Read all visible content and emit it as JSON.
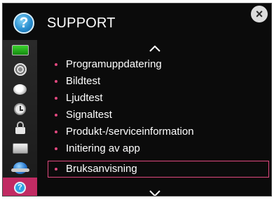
{
  "header": {
    "title": "SUPPORT",
    "badge_glyph": "?",
    "close_glyph": "×"
  },
  "sidebar": {
    "items": [
      {
        "icon": "tv-icon",
        "active": false
      },
      {
        "icon": "speaker-icon",
        "active": false
      },
      {
        "icon": "disc-icon",
        "active": false
      },
      {
        "icon": "clock-icon",
        "active": false
      },
      {
        "icon": "lock-icon",
        "active": false
      },
      {
        "icon": "hard-drive-icon",
        "active": false
      },
      {
        "icon": "globe-icon",
        "active": false
      },
      {
        "icon": "help-icon",
        "active": true,
        "glyph": "?"
      }
    ]
  },
  "menu": {
    "items": [
      {
        "label": "Programuppdatering",
        "selected": false
      },
      {
        "label": "Bildtest",
        "selected": false
      },
      {
        "label": "Ljudtest",
        "selected": false
      },
      {
        "label": "Signaltest",
        "selected": false
      },
      {
        "label": "Produkt-/serviceinformation",
        "selected": false
      },
      {
        "label": "Initiering av app",
        "selected": false
      },
      {
        "label": "Bruksanvisning",
        "selected": true
      }
    ]
  },
  "colors": {
    "panel_background": "#0b0b0b",
    "accent": "#c12b63",
    "bullet": "#e0487f",
    "text": "#ffffff"
  }
}
